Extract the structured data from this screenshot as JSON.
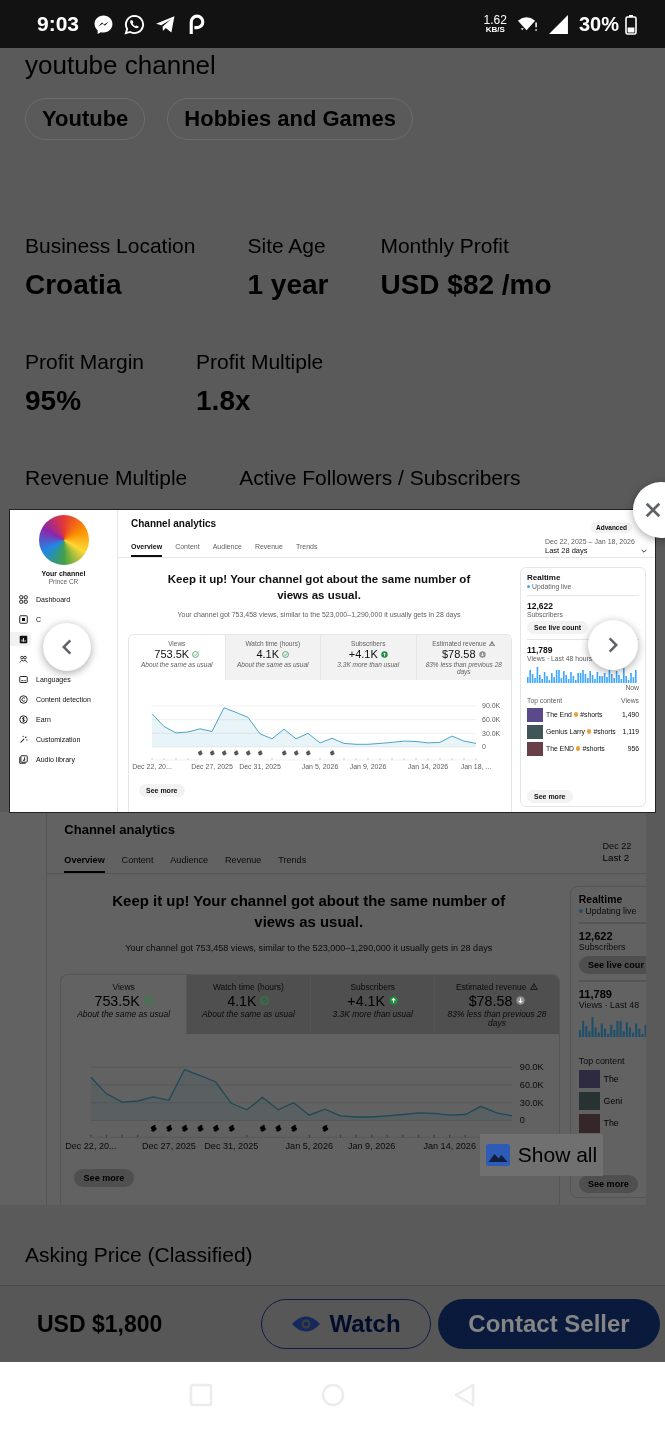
{
  "status_bar": {
    "time": "9:03",
    "net_speed": "1.62",
    "net_unit": "KB/S",
    "battery": "30%"
  },
  "listing": {
    "title_fragment": "youtube channel",
    "tags": [
      "Youtube",
      "Hobbies and Games"
    ],
    "stat_rows": [
      [
        {
          "label": "Business Location",
          "value": "Croatia"
        },
        {
          "label": "Site Age",
          "value": "1 year"
        },
        {
          "label": "Monthly Profit",
          "value": "USD $82 /mo"
        }
      ],
      [
        {
          "label": "Profit Margin",
          "value": "95%"
        },
        {
          "label": "Profit Multiple",
          "value": "1.8x"
        }
      ],
      [
        {
          "label": "Revenue Multiple"
        },
        {
          "label": "Active Followers / Subscribers"
        }
      ]
    ],
    "gallery_image": {
      "title": "Channel analytics",
      "tabs": [
        {
          "label": "Overview",
          "selected": true
        },
        {
          "label": "Content",
          "selected": false
        },
        {
          "label": "Audience",
          "selected": false
        },
        {
          "label": "Revenue",
          "selected": false
        },
        {
          "label": "Trends",
          "selected": false
        }
      ],
      "date_range": "Dec 22",
      "period": "Last 2",
      "headline": "Keep it up! Your channel got about the same number of views as usual.",
      "summary": "Your channel got 753,458 views, similar to the 523,000–1,290,000 it usually gets in 28 days",
      "metrics": [
        {
          "label": "Views",
          "value": "753.5K",
          "kind": "check",
          "note": "About the same as usual",
          "selected": true
        },
        {
          "label": "Watch time (hours)",
          "value": "4.1K",
          "kind": "check",
          "note": "About the same as usual",
          "selected": false
        },
        {
          "label": "Subscribers",
          "value": "+4.1K",
          "kind": "up",
          "note": "3.3K more than usual",
          "selected": false
        },
        {
          "label": "Estimated revenue",
          "warning": true,
          "value": "$78.58",
          "kind": "down",
          "note": "83% less than previous 28 days",
          "selected": false
        }
      ],
      "chart_data": {
        "type": "area",
        "ylim": [
          0,
          90000
        ],
        "categories": [
          "Dec 22, 20...",
          null,
          null,
          null,
          null,
          "Dec 27, 2025",
          null,
          null,
          null,
          "Dec 31, 2025",
          null,
          null,
          null,
          null,
          "Jan 5, 2026",
          null,
          null,
          null,
          "Jan 9, 2026",
          null,
          null,
          null,
          null,
          "Jan 14, 2026",
          null,
          null,
          null,
          null
        ],
        "yticks": [
          {
            "value": 0,
            "label": "0"
          },
          {
            "value": 30000,
            "label": "30.0K"
          },
          {
            "value": 60000,
            "label": "60.0K"
          },
          {
            "value": 90000,
            "label": "90.0K"
          }
        ],
        "series": [
          {
            "color": "#1d4a5a",
            "values": [
              73000,
              45000,
              31000,
              33000,
              40000,
              34000,
              86000,
              76000,
              65000,
              29000,
              18000,
              39000,
              18000,
              30000,
              9000,
              19000,
              8000,
              6000,
              6000,
              8000,
              10000,
              13000,
              12000,
              9000,
              10000,
              24000,
              13000,
              8000
            ]
          }
        ]
      },
      "video_markers": [
        false,
        false,
        false,
        false,
        true,
        true,
        true,
        true,
        true,
        true,
        false,
        true,
        true,
        true,
        false,
        true,
        false,
        false,
        false,
        false,
        false,
        false,
        false,
        false,
        false,
        false,
        false,
        false
      ],
      "see_more": "See more",
      "realtime": {
        "title": "Realtime",
        "live": "Updating live",
        "subscribers": "12,622",
        "subscribers_label": "Subscribers",
        "live_count_button": "See live cour",
        "views": "11,789",
        "views_label": "Views · Last 48",
        "top_content": "Top content",
        "videos": [
          {
            "title": "The",
            "color": "#2e2a40"
          },
          {
            "title": "Geni",
            "color": "#283232"
          },
          {
            "title": "The",
            "color": "#352629"
          }
        ],
        "see_more": "See more"
      }
    },
    "show_all": "Show all",
    "asking_price_label": "Asking Price (Classified)"
  },
  "bottom_bar": {
    "price": "USD $1,800",
    "watch": "Watch",
    "contact": "Contact Seller"
  },
  "lightbox": {
    "image": {
      "sidebar": {
        "channel_name": "Your channel",
        "handle": "Prince CR",
        "items": [
          {
            "kind": "dashboard",
            "label": "Dashboard",
            "selected": false
          },
          {
            "kind": "content",
            "label": "C",
            "selected": false
          },
          {
            "kind": "analytics",
            "selected": true
          },
          {
            "kind": "community",
            "selected": false
          },
          {
            "kind": "languages",
            "label": "Languages",
            "selected": false
          },
          {
            "kind": "copyright",
            "label": "Content detection",
            "selected": false
          },
          {
            "kind": "earn",
            "label": "Earn",
            "selected": false
          },
          {
            "kind": "customization",
            "label": "Customization",
            "selected": false
          },
          {
            "kind": "audio",
            "label": "Audio library",
            "selected": false
          }
        ]
      },
      "title": "Channel analytics",
      "tabs": [
        {
          "label": "Overview",
          "selected": true
        },
        {
          "label": "Content",
          "selected": false
        },
        {
          "label": "Audience",
          "selected": false
        },
        {
          "label": "Revenue",
          "selected": false
        },
        {
          "label": "Trends",
          "selected": false
        }
      ],
      "advanced_button": "Advanced",
      "date_range": "Dec 22, 2025 – Jan 18, 2026",
      "period": "Last 28 days",
      "dropdown": true,
      "headline": "Keep it up! Your channel got about the same number of views as usual.",
      "summary": "Your channel got 753,458 views, similar to the 523,000–1,290,000 it usually gets in 28 days",
      "metrics": [
        {
          "label": "Views",
          "value": "753.5K",
          "kind": "check",
          "note": "About the same as usual",
          "selected": true
        },
        {
          "label": "Watch time (hours)",
          "value": "4.1K",
          "kind": "check",
          "note": "About the same as usual",
          "selected": false
        },
        {
          "label": "Subscribers",
          "value": "+4.1K",
          "kind": "up",
          "note": "3.3K more than usual",
          "selected": false
        },
        {
          "label": "Estimated revenue",
          "warning": true,
          "value": "$78.58",
          "kind": "down",
          "note": "83% less than previous 28 days",
          "selected": false
        }
      ],
      "chart_data": {
        "type": "area",
        "ylim": [
          0,
          90000
        ],
        "categories": [
          "Dec 22, 20...",
          null,
          null,
          null,
          null,
          "Dec 27, 2025",
          null,
          null,
          null,
          "Dec 31, 2025",
          null,
          null,
          null,
          null,
          "Jan 5, 2026",
          null,
          null,
          null,
          "Jan 9, 2026",
          null,
          null,
          null,
          null,
          "Jan 14, 2026",
          null,
          null,
          null,
          "Jan 18, ..."
        ],
        "yticks": [
          {
            "value": 0,
            "label": "0"
          },
          {
            "value": 30000,
            "label": "30.0K"
          },
          {
            "value": 60000,
            "label": "60.0K"
          },
          {
            "value": 90000,
            "label": "90.0K"
          }
        ],
        "series": [
          {
            "color": "#4aa5c9",
            "values": [
              73000,
              45000,
              31000,
              33000,
              40000,
              34000,
              86000,
              76000,
              65000,
              29000,
              18000,
              39000,
              18000,
              30000,
              9000,
              19000,
              8000,
              6000,
              6000,
              8000,
              10000,
              13000,
              12000,
              9000,
              10000,
              24000,
              13000,
              8000
            ]
          }
        ]
      },
      "video_markers": [
        false,
        false,
        false,
        false,
        true,
        true,
        true,
        true,
        true,
        true,
        false,
        true,
        true,
        true,
        false,
        true,
        false,
        false,
        false,
        false,
        false,
        false,
        false,
        false,
        false,
        false,
        false,
        false
      ],
      "see_more": "See more",
      "realtime": {
        "title": "Realtime",
        "live": "Updating live",
        "subscribers": "12,622",
        "subscribers_label": "Subscribers",
        "live_count_button": "See live count",
        "views": "11,789",
        "views_label": "Views · Last 48 hours",
        "now": "Now",
        "top_content": "Top content",
        "views_header": "Views",
        "videos": [
          {
            "title": "The End",
            "tag": "#shorts",
            "views": "1,490",
            "color": "#5b4a8a"
          },
          {
            "title": "Genius Larry",
            "tag": "#shorts",
            "views": "1,119",
            "color": "#3f5556"
          },
          {
            "title": "The END",
            "tag": "#shorts",
            "views": "956",
            "color": "#6a4048"
          }
        ],
        "see_more": "See more"
      }
    }
  }
}
